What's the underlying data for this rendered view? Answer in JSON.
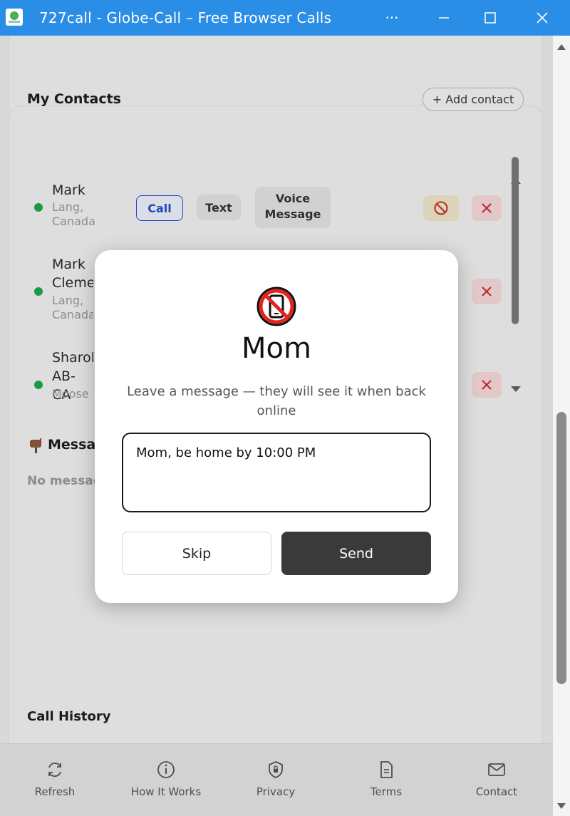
{
  "window": {
    "title": "727call - Globe-Call – Free Browser Calls",
    "controls": {
      "more": "···",
      "minimize": "—",
      "maximize": "☐",
      "close": "✕"
    }
  },
  "contacts": {
    "title": "My Contacts",
    "add_button": "+ Add contact",
    "items": [
      {
        "name": "Mark",
        "location": "Lang,\nCanada",
        "status": "online",
        "call": "Call",
        "text": "Text",
        "voice": "Voice Message"
      },
      {
        "name": "Mark Cleme",
        "location": "Lang, Canada",
        "status": "online"
      },
      {
        "name": "Sharol AB-CA",
        "location": "Moose",
        "status": "online"
      }
    ]
  },
  "messages": {
    "title": "Messag",
    "empty": "No messag"
  },
  "call_history": {
    "title": "Call History"
  },
  "nav": [
    {
      "label": "Refresh",
      "icon": "refresh-icon"
    },
    {
      "label": "How It Works",
      "icon": "info-icon"
    },
    {
      "label": "Privacy",
      "icon": "shield-icon"
    },
    {
      "label": "Terms",
      "icon": "document-icon"
    },
    {
      "label": "Contact",
      "icon": "mail-icon"
    }
  ],
  "modal": {
    "icon": "no-phone-icon",
    "name": "Mom",
    "subtitle": "Leave a message — they will see it when back online",
    "message_value": "Mom, be home by 10:00 PM",
    "skip_label": "Skip",
    "send_label": "Send"
  },
  "colors": {
    "titlebar": "#2a8ee6",
    "online": "#1fa64c",
    "call_accent": "#2450c8",
    "send_bg": "#3a3a3a"
  }
}
